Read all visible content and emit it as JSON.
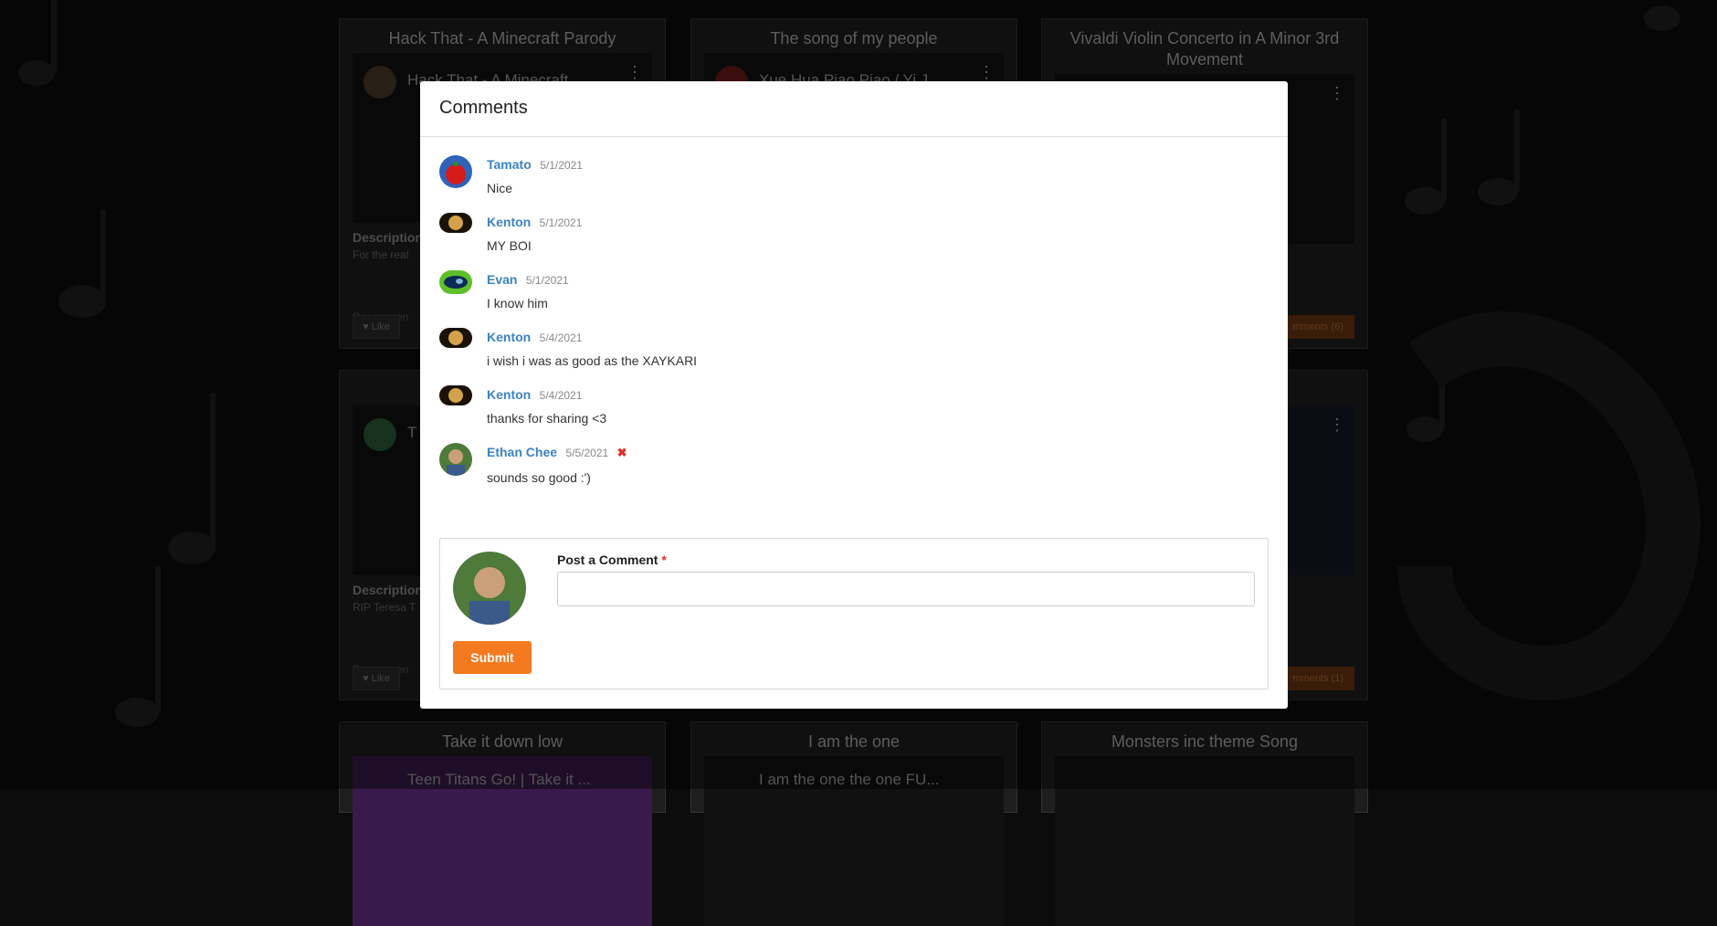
{
  "background_cards": [
    {
      "title": "Hack That - A Minecraft Parody",
      "video_title": "Hack That - A Minecraft",
      "description_label": "Description",
      "description": "For the real",
      "recommend": "Recommen",
      "like": "♥ Like"
    },
    {
      "title": "The song of my people",
      "video_title": "Xue Hua Piao Piao / Yi J",
      "description_label": "",
      "description": "",
      "recommend": "",
      "like": ""
    },
    {
      "title": "Vivaldi Violin Concerto in A Minor 3rd Movement",
      "video_title": "",
      "comments_button": "mments (6)"
    },
    {
      "title": "",
      "video_title": "T",
      "description_label": "Description",
      "description": "RIP Teresa T",
      "recommend": "Recommen",
      "like": "♥ Like"
    },
    {
      "title": "",
      "video_title": "",
      "comments_button": "mments (1)"
    },
    {
      "title": "Take it down low",
      "video_title": "Teen Titans Go! | Take it ..."
    },
    {
      "title": "I am the one",
      "video_title": "I am the one the one FU..."
    },
    {
      "title": "Monsters inc theme Song",
      "video_title": ""
    }
  ],
  "modal": {
    "title": "Comments",
    "comments": [
      {
        "author": "Tamato",
        "date": "5/1/2021",
        "text": "Nice"
      },
      {
        "author": "Kenton",
        "date": "5/1/2021",
        "text": "MY BOI"
      },
      {
        "author": "Evan",
        "date": "5/1/2021",
        "text": "I know him"
      },
      {
        "author": "Kenton",
        "date": "5/4/2021",
        "text": "i wish i was as good as the XAYKARI"
      },
      {
        "author": "Kenton",
        "date": "5/4/2021",
        "text": "thanks for sharing <3"
      },
      {
        "author": "Ethan Chee",
        "date": "5/5/2021",
        "text": "sounds so good :')",
        "delete_icon": "✖"
      }
    ],
    "post": {
      "label": "Post a Comment",
      "required_mark": "*",
      "value": "",
      "submit_label": "Submit"
    }
  },
  "colors": {
    "accent": "#f47a20",
    "author_link": "#3b82c4",
    "delete": "#d9342b"
  }
}
